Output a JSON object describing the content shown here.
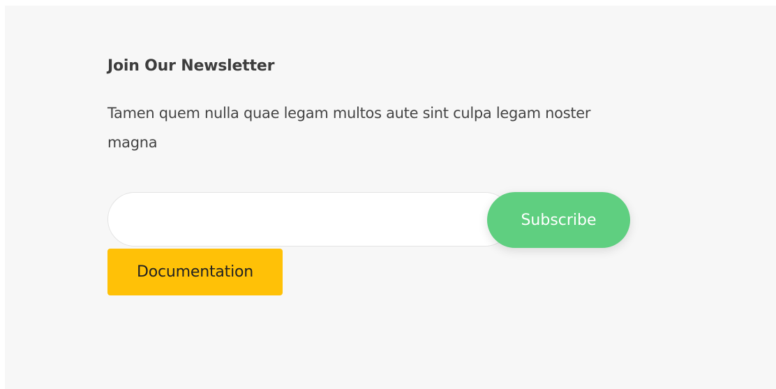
{
  "newsletter": {
    "title": "Join Our Newsletter",
    "description": "Tamen quem nulla quae legam multos aute sint culpa legam noster magna",
    "email_value": "",
    "email_placeholder": "",
    "subscribe_label": "Subscribe"
  },
  "documentation": {
    "label": "Documentation"
  },
  "colors": {
    "section_background": "#f7f7f7",
    "subscribe_button": "#5fcf80",
    "documentation_button": "#ffc107",
    "heading_text": "#3d3d3d",
    "body_text": "#444444"
  }
}
